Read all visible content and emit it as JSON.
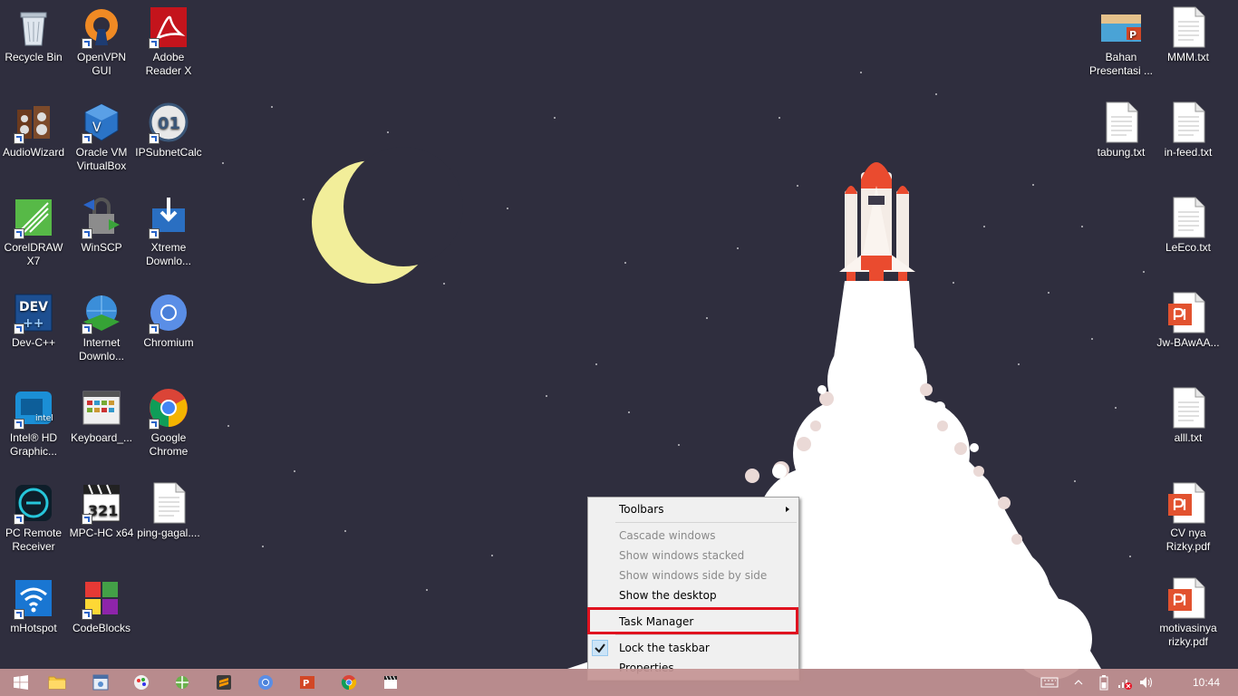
{
  "desktop_icons": [
    {
      "id": "recycle-bin",
      "label": "Recycle Bin",
      "icon": "recycle-bin-icon",
      "shortcut": false
    },
    {
      "id": "openvpn",
      "label": "OpenVPN GUI",
      "icon": "openvpn-icon",
      "shortcut": true
    },
    {
      "id": "adobe-reader",
      "label": "Adobe Reader X",
      "icon": "adobe-reader-icon",
      "shortcut": true
    },
    {
      "id": "audiowizard",
      "label": "AudioWizard",
      "icon": "audiowizard-icon",
      "shortcut": true
    },
    {
      "id": "virtualbox",
      "label": "Oracle VM VirtualBox",
      "icon": "virtualbox-icon",
      "shortcut": true
    },
    {
      "id": "ipsubnetcalc",
      "label": "IPSubnetCalc",
      "icon": "ipsubnetcalc-icon",
      "shortcut": true
    },
    {
      "id": "coreldraw",
      "label": "CorelDRAW X7",
      "icon": "coreldraw-icon",
      "shortcut": true
    },
    {
      "id": "winscp",
      "label": "WinSCP",
      "icon": "winscp-icon",
      "shortcut": true
    },
    {
      "id": "xtreme",
      "label": "Xtreme Downlo...",
      "icon": "xtreme-download-icon",
      "shortcut": true
    },
    {
      "id": "devcpp",
      "label": "Dev-C++",
      "icon": "devcpp-icon",
      "shortcut": true
    },
    {
      "id": "idm",
      "label": "Internet Downlo...",
      "icon": "internet-download-manager-icon",
      "shortcut": true
    },
    {
      "id": "chromium",
      "label": "Chromium",
      "icon": "chromium-icon",
      "shortcut": true
    },
    {
      "id": "intel-hd",
      "label": "Intel® HD Graphic...",
      "icon": "intel-graphics-icon",
      "shortcut": true
    },
    {
      "id": "keyboard",
      "label": "Keyboard_...",
      "icon": "keyboard-app-icon",
      "shortcut": false
    },
    {
      "id": "chrome",
      "label": "Google Chrome",
      "icon": "chrome-icon",
      "shortcut": true
    },
    {
      "id": "pc-remote",
      "label": "PC Remote Receiver",
      "icon": "pc-remote-icon",
      "shortcut": true
    },
    {
      "id": "mpc-hc",
      "label": "MPC-HC x64",
      "icon": "mpc-hc-icon",
      "shortcut": true
    },
    {
      "id": "ping-gagal",
      "label": "ping-gagal....",
      "icon": "text-file-icon",
      "shortcut": false
    },
    {
      "id": "mhotspot",
      "label": "mHotspot",
      "icon": "wifi-icon",
      "shortcut": true
    },
    {
      "id": "codeblocks",
      "label": "CodeBlocks",
      "icon": "codeblocks-icon",
      "shortcut": true
    },
    {
      "id": "bahan-presentasi",
      "label": "Bahan Presentasi ...",
      "icon": "powerpoint-file-icon",
      "shortcut": false
    },
    {
      "id": "mmm-txt",
      "label": "MMM.txt",
      "icon": "text-file-icon",
      "shortcut": false
    },
    {
      "id": "tabung-txt",
      "label": "tabung.txt",
      "icon": "text-file-icon",
      "shortcut": false
    },
    {
      "id": "in-feed-txt",
      "label": "in-feed.txt",
      "icon": "text-file-icon",
      "shortcut": false
    },
    {
      "id": "leeco-txt",
      "label": "LeEco.txt",
      "icon": "text-file-icon",
      "shortcut": false
    },
    {
      "id": "jw-bawaa",
      "label": "Jw-BAwAA...",
      "icon": "pdf-file-icon",
      "shortcut": false
    },
    {
      "id": "alll-txt",
      "label": "alll.txt",
      "icon": "text-file-icon",
      "shortcut": false
    },
    {
      "id": "cv-nya-rizky",
      "label": "CV nya Rizky.pdf",
      "icon": "pdf-file-icon",
      "shortcut": false
    },
    {
      "id": "motivasinya-rizky",
      "label": "motivasinya rizky.pdf",
      "icon": "pdf-file-icon",
      "shortcut": false
    }
  ],
  "context_menu": {
    "items": [
      {
        "label": "Toolbars",
        "enabled": true,
        "submenu": true,
        "checked": false
      },
      {
        "label": "Cascade windows",
        "enabled": false,
        "submenu": false,
        "checked": false
      },
      {
        "label": "Show windows stacked",
        "enabled": false,
        "submenu": false,
        "checked": false
      },
      {
        "label": "Show windows side by side",
        "enabled": false,
        "submenu": false,
        "checked": false
      },
      {
        "label": "Show the desktop",
        "enabled": true,
        "submenu": false,
        "checked": false
      },
      {
        "label": "Task Manager",
        "enabled": true,
        "submenu": false,
        "checked": false,
        "highlighted": true
      },
      {
        "label": "Lock the taskbar",
        "enabled": true,
        "submenu": false,
        "checked": true
      },
      {
        "label": "Properties",
        "enabled": true,
        "submenu": false,
        "checked": false
      }
    ],
    "highlight_color": "#e0121f"
  },
  "taskbar": {
    "apps": [
      {
        "id": "start",
        "icon": "windows-start-icon"
      },
      {
        "id": "explorer",
        "icon": "file-explorer-icon"
      },
      {
        "id": "app-2",
        "icon": "window-app-icon"
      },
      {
        "id": "app-3",
        "icon": "paint-app-icon"
      },
      {
        "id": "app-4",
        "icon": "network-app-icon"
      },
      {
        "id": "sublime",
        "icon": "sublime-text-icon"
      },
      {
        "id": "chromium",
        "icon": "chromium-icon"
      },
      {
        "id": "powerpoint",
        "icon": "powerpoint-icon"
      },
      {
        "id": "chrome",
        "icon": "chrome-icon"
      },
      {
        "id": "mpc",
        "icon": "clapperboard-icon"
      }
    ],
    "tray_icons": [
      "keyboard-icon",
      "show-hidden-icons-chevron",
      "battery-icon",
      "network-error-icon",
      "volume-icon"
    ],
    "clock": "10:44",
    "color": "#c49494"
  },
  "wallpaper": {
    "background": "#2f2e3e",
    "moon_color": "#f2ee9a",
    "smoke_color": "#ffffff"
  }
}
